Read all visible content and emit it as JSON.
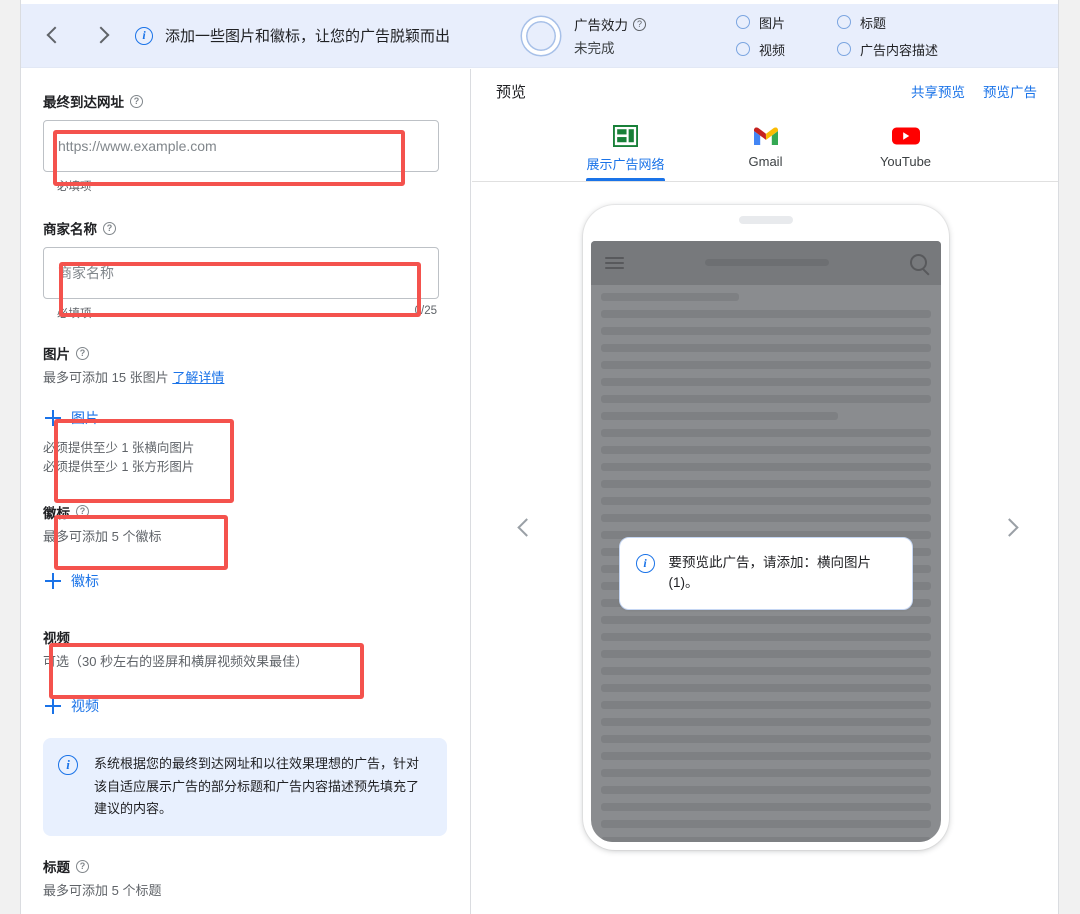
{
  "header": {
    "back_icon": "chevron-left-icon",
    "forward_icon": "chevron-right-icon",
    "info_icon": "info-icon",
    "title": "添加一些图片和徽标，让您的广告脱颖而出",
    "ad_strength": {
      "label": "广告效力",
      "help_icon": "help-icon",
      "status": "未完成"
    },
    "checklist": [
      {
        "label": "图片",
        "checked": false
      },
      {
        "label": "标题",
        "checked": false
      },
      {
        "label": "视频",
        "checked": false
      },
      {
        "label": "广告内容描述",
        "checked": false
      }
    ]
  },
  "form": {
    "final_url": {
      "label": "最终到达网址",
      "help_icon": "help-icon",
      "value": "",
      "placeholder": "https://www.example.com",
      "helper": "必填项"
    },
    "business_name": {
      "label": "商家名称",
      "help_icon": "help-icon",
      "value": "",
      "placeholder": "商家名称",
      "helper": "必填项",
      "counter": "0/25"
    },
    "images": {
      "label": "图片",
      "help_icon": "help-icon",
      "sub": "最多可添加 15 张图片",
      "learn_more": "了解详情",
      "add_label": "图片",
      "requirements": [
        "必须提供至少 1 张横向图片",
        "必须提供至少 1 张方形图片"
      ]
    },
    "logos": {
      "label": "徽标",
      "help_icon": "help-icon",
      "sub": "最多可添加 5 个徽标",
      "add_label": "徽标"
    },
    "videos": {
      "label": "视频",
      "sub": "可选（30 秒左右的竖屏和横屏视频效果最佳）",
      "add_label": "视频"
    },
    "info_note": {
      "icon": "info-icon",
      "text": "系统根据您的最终到达网址和以往效果理想的广告，针对该自适应展示广告的部分标题和广告内容描述预先填充了建议的内容。"
    },
    "headlines": {
      "label": "标题",
      "help_icon": "help-icon",
      "sub": "最多可添加 5 个标题"
    }
  },
  "preview": {
    "title": "预览",
    "share_link": "共享预览",
    "preview_link": "预览广告",
    "tabs": [
      {
        "label": "展示广告网络",
        "icon": "display-network-icon",
        "active": true
      },
      {
        "label": "Gmail",
        "icon": "gmail-icon",
        "active": false
      },
      {
        "label": "YouTube",
        "icon": "youtube-icon",
        "active": false
      }
    ],
    "prev_icon": "chevron-left-icon",
    "next_icon": "chevron-right-icon",
    "notice": {
      "icon": "info-icon",
      "text": "要预览此广告，请添加：横向图片 (1)。"
    },
    "mock_phone": {
      "menu_icon": "hamburger-icon",
      "search_icon": "search-icon"
    }
  },
  "colors": {
    "accent_blue": "#1a73e8",
    "header_bg": "#e8eefc",
    "annotation_red": "#f4524d",
    "info_bg": "#e8f0fe"
  }
}
